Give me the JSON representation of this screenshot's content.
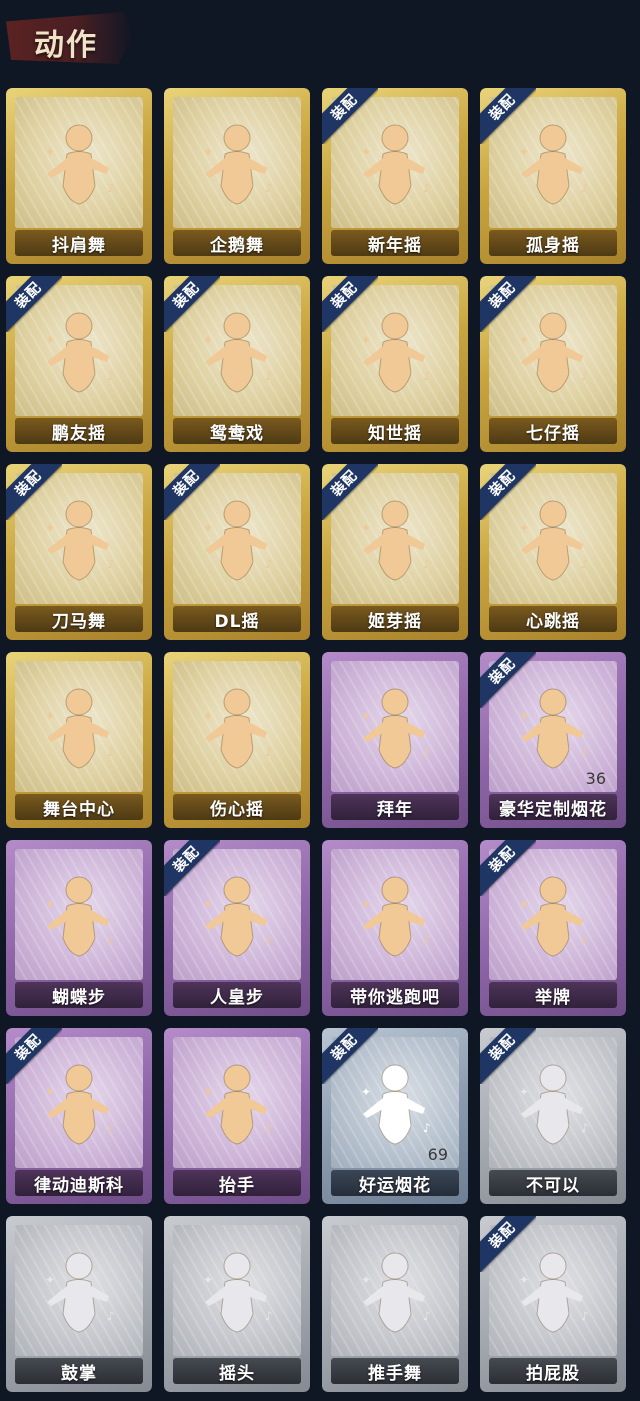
{
  "header": {
    "title": "动作"
  },
  "badge_text": "装配",
  "cards": [
    {
      "label": "抖肩舞",
      "tier": "gold",
      "equipped": false,
      "count": "",
      "figure": "dancer-icon"
    },
    {
      "label": "企鹅舞",
      "tier": "gold",
      "equipped": false,
      "count": "",
      "figure": "dancer-icon"
    },
    {
      "label": "新年摇",
      "tier": "gold",
      "equipped": true,
      "count": "",
      "figure": "dancer-icon"
    },
    {
      "label": "孤身摇",
      "tier": "gold",
      "equipped": true,
      "count": "",
      "figure": "dancer-icon"
    },
    {
      "label": "鹏友摇",
      "tier": "gold",
      "equipped": true,
      "count": "",
      "figure": "dancer-icon"
    },
    {
      "label": "鸳鸯戏",
      "tier": "gold",
      "equipped": true,
      "count": "",
      "figure": "dancer-icon"
    },
    {
      "label": "知世摇",
      "tier": "gold",
      "equipped": true,
      "count": "",
      "figure": "dancer-icon"
    },
    {
      "label": "七仔摇",
      "tier": "gold",
      "equipped": true,
      "count": "",
      "figure": "dancer-icon"
    },
    {
      "label": "刀马舞",
      "tier": "gold",
      "equipped": true,
      "count": "",
      "figure": "dancer-icon"
    },
    {
      "label": "DL摇",
      "tier": "gold",
      "equipped": true,
      "count": "",
      "figure": "dancer-icon"
    },
    {
      "label": "姬芽摇",
      "tier": "gold",
      "equipped": true,
      "count": "",
      "figure": "dancer-icon"
    },
    {
      "label": "心跳摇",
      "tier": "gold",
      "equipped": true,
      "count": "",
      "figure": "dancer-icon"
    },
    {
      "label": "舞台中心",
      "tier": "gold",
      "equipped": false,
      "count": "",
      "figure": "dancer-icon"
    },
    {
      "label": "伤心摇",
      "tier": "gold",
      "equipped": false,
      "count": "",
      "figure": "heart-pose-icon"
    },
    {
      "label": "拜年",
      "tier": "purple",
      "equipped": false,
      "count": "",
      "figure": "greeting-icon"
    },
    {
      "label": "豪华定制烟花",
      "tier": "purple",
      "equipped": true,
      "count": "36",
      "figure": "fireworks-icon"
    },
    {
      "label": "蝴蝶步",
      "tier": "purple",
      "equipped": false,
      "count": "",
      "figure": "dancer-icon"
    },
    {
      "label": "人皇步",
      "tier": "purple",
      "equipped": true,
      "count": "",
      "figure": "dancer-icon"
    },
    {
      "label": "带你逃跑吧",
      "tier": "purple",
      "equipped": false,
      "count": "",
      "figure": "dancer-icon"
    },
    {
      "label": "举牌",
      "tier": "purple",
      "equipped": true,
      "count": "",
      "figure": "sign-icon"
    },
    {
      "label": "律动迪斯科",
      "tier": "purple",
      "equipped": true,
      "count": "",
      "figure": "dancer-icon"
    },
    {
      "label": "抬手",
      "tier": "purple",
      "equipped": false,
      "count": "",
      "figure": "hand-raise-icon"
    },
    {
      "label": "好运烟花",
      "tier": "blue",
      "equipped": true,
      "count": "69",
      "figure": "firework-tube-icon"
    },
    {
      "label": "不可以",
      "tier": "gray",
      "equipped": true,
      "count": "",
      "figure": "finger-icon"
    },
    {
      "label": "鼓掌",
      "tier": "gray",
      "equipped": false,
      "count": "",
      "figure": "clap-icon"
    },
    {
      "label": "摇头",
      "tier": "gray",
      "equipped": false,
      "count": "",
      "figure": "dancer-icon"
    },
    {
      "label": "推手舞",
      "tier": "gray",
      "equipped": false,
      "count": "",
      "figure": "dancer-icon"
    },
    {
      "label": "拍屁股",
      "tier": "gray",
      "equipped": true,
      "count": "",
      "figure": "dancer-icon"
    }
  ]
}
